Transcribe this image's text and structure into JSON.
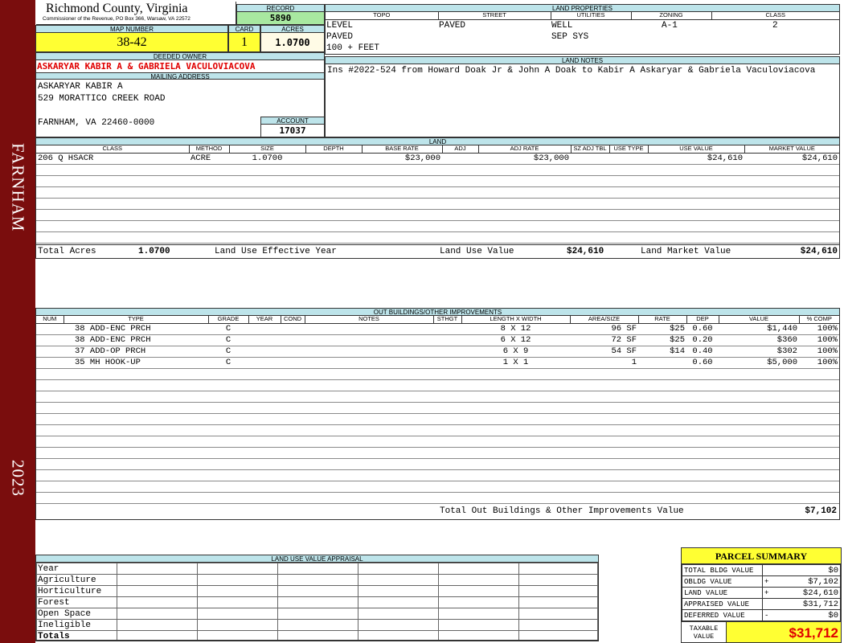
{
  "sidebar": {
    "district": "FARNHAM",
    "year": "2023"
  },
  "header": {
    "county": "Richmond County, Virginia",
    "office": "Commissioner of the Revenue, PO Box 366, Warsaw, VA 22572",
    "record_label": "RECORD",
    "record": "5890",
    "map_label": "MAP NUMBER",
    "map_number": "38-42",
    "card_label": "CARD",
    "card": "1",
    "acres_label": "ACRES",
    "acres": "1.0700"
  },
  "owner": {
    "deeded_label": "DEEDED OWNER",
    "deeded_owner": "ASKARYAR KABIR A & GABRIELA VACULOVIACOVA",
    "mailing_label": "MAILING ADDRESS",
    "mailing_lines": [
      "ASKARYAR KABIR A",
      "529 MORATTICO CREEK ROAD",
      "",
      "FARNHAM, VA 22460-0000"
    ],
    "account_label": "ACCOUNT",
    "account": "17037"
  },
  "land_properties": {
    "title": "LAND PROPERTIES",
    "headers": [
      "TOPO",
      "STREET",
      "UTILITIES",
      "ZONING",
      "CLASS"
    ],
    "topo": [
      "LEVEL",
      "PAVED",
      "100 + FEET"
    ],
    "street": [
      "PAVED"
    ],
    "utilities": [
      "WELL",
      "SEP SYS"
    ],
    "zoning": "A-1",
    "class": "2"
  },
  "land_notes": {
    "title": "LAND NOTES",
    "text": "Ins #2022-524 from Howard Doak Jr & John A Doak to Kabir A Askaryar & Gabriela Vaculoviacova"
  },
  "land": {
    "title": "LAND",
    "headers": [
      "CLASS",
      "METHOD",
      "SIZE",
      "DEPTH",
      "BASE RATE",
      "ADJ",
      "ADJ RATE",
      "SZ ADJ TBL",
      "USE TYPE",
      "USE VALUE",
      "MARKET VALUE"
    ],
    "rows": [
      [
        "206 Q HSACR",
        "ACRE",
        "1.0700",
        "",
        "$23,000",
        "",
        "$23,000",
        "",
        "",
        "$24,610",
        "$24,610"
      ]
    ],
    "totals": {
      "total_acres_label": "Total Acres",
      "total_acres": "1.0700",
      "effective_year_label": "Land Use Effective Year",
      "use_value_label": "Land Use Value",
      "use_value": "$24,610",
      "market_value_label": "Land Market Value",
      "market_value": "$24,610"
    }
  },
  "outbuildings": {
    "title": "OUT BUILDINGS/OTHER IMPROVEMENTS",
    "headers": [
      "NUM",
      "TYPE",
      "GRADE",
      "YEAR",
      "COND",
      "NOTES",
      "STHGT",
      "LENGTH X WIDTH",
      "AREA/SIZE",
      "RATE",
      "DEP",
      "VALUE",
      "% COMP"
    ],
    "rows": [
      [
        "",
        "38  ADD-ENC PRCH",
        "C",
        "",
        "",
        "",
        "",
        "8 X 12",
        "96 SF",
        "$25",
        "0.60",
        "$1,440",
        "100%"
      ],
      [
        "",
        "38  ADD-ENC PRCH",
        "C",
        "",
        "",
        "",
        "",
        "6 X 12",
        "72 SF",
        "$25",
        "0.20",
        "$360",
        "100%"
      ],
      [
        "",
        "37  ADD-OP PRCH",
        "C",
        "",
        "",
        "",
        "",
        "6 X 9",
        "54 SF",
        "$14",
        "0.40",
        "$302",
        "100%"
      ],
      [
        "",
        "35  MH HOOK-UP",
        "C",
        "",
        "",
        "",
        "",
        "1 X 1",
        "1",
        "",
        "0.60",
        "$5,000",
        "100%"
      ]
    ],
    "total_label": "Total Out Buildings & Other Improvements Value",
    "total": "$7,102"
  },
  "land_use_appraisal": {
    "title": "LAND USE VALUE APPRAISAL",
    "rows": [
      "Year",
      "Agriculture",
      "Horticulture",
      "Forest",
      "Open Space",
      "Ineligible",
      "Totals"
    ]
  },
  "parcel_summary": {
    "title": "PARCEL SUMMARY",
    "rows": [
      {
        "label": "TOTAL BLDG VALUE",
        "sign": "",
        "value": "$0"
      },
      {
        "label": "OBLDG VALUE",
        "sign": "+",
        "value": "$7,102"
      },
      {
        "label": "LAND VALUE",
        "sign": "+",
        "value": "$24,610"
      },
      {
        "label": "APPRAISED VALUE",
        "sign": "",
        "value": "$31,712"
      },
      {
        "label": "DEFERRED VALUE",
        "sign": "-",
        "value": "$0"
      }
    ],
    "taxable_label": "TAXABLE VALUE",
    "taxable": "$31,712"
  },
  "colors": {
    "sidebar": "#7a0d0d",
    "caption": "#bde4ea",
    "highlight": "#ffff33",
    "record": "#a8e8a0",
    "alert": "#e00000"
  }
}
